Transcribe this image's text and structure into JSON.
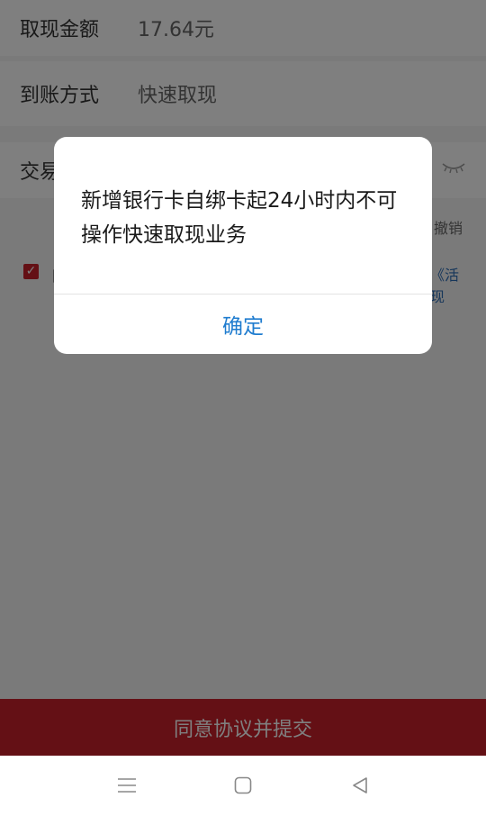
{
  "form": {
    "amount_label": "取现金额",
    "amount_value": "17.64元",
    "method_label": "到账方式",
    "method_value": "快速取现",
    "password_label": "交易",
    "hint_text": "撤销",
    "agree_text": "同",
    "link_text_1": "《活",
    "link_text_2": "现"
  },
  "submit_label": "同意协议并提交",
  "dialog": {
    "message": "新增银行卡自绑卡起24小时内不可操作快速取现业务",
    "confirm_label": "确定"
  },
  "nav": {
    "menu_icon": "menu-icon",
    "home_icon": "home-icon",
    "back_icon": "back-icon"
  },
  "colors": {
    "accent_red": "#c8202a",
    "link_blue": "#1f7ccf"
  }
}
